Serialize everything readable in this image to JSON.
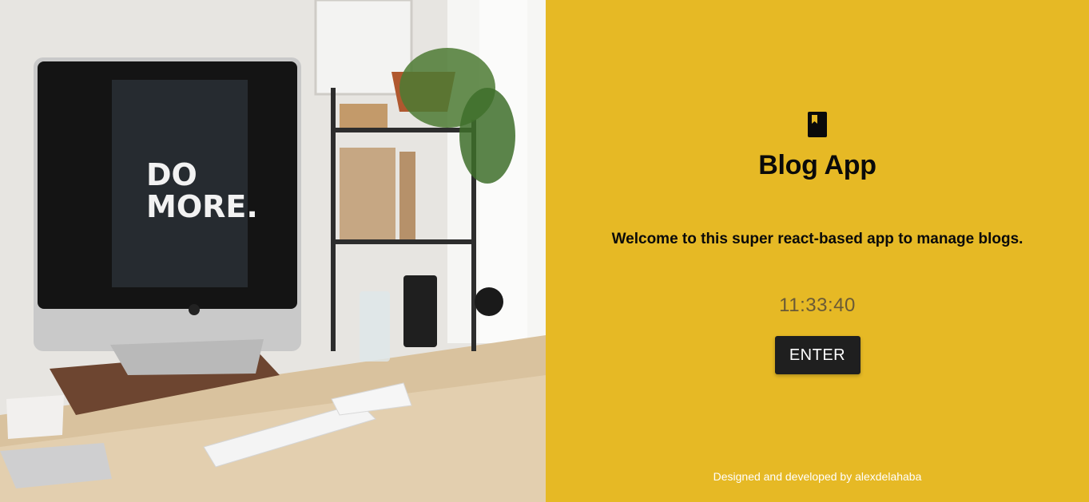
{
  "hero": {
    "image_alt": "Desk workspace with iMac displaying DO MORE.",
    "screen_text_line1": "DO",
    "screen_text_line2": "MORE."
  },
  "app": {
    "icon": "book-icon",
    "title": "Blog App",
    "welcome": "Welcome to this super react-based app to manage blogs.",
    "clock": "11:33:40",
    "enter_label": "ENTER",
    "footer": "Designed and developed by alexdelahaba"
  },
  "colors": {
    "accent": "#e6b925",
    "button": "#1f1f1f",
    "footer_text": "#ffffff"
  }
}
